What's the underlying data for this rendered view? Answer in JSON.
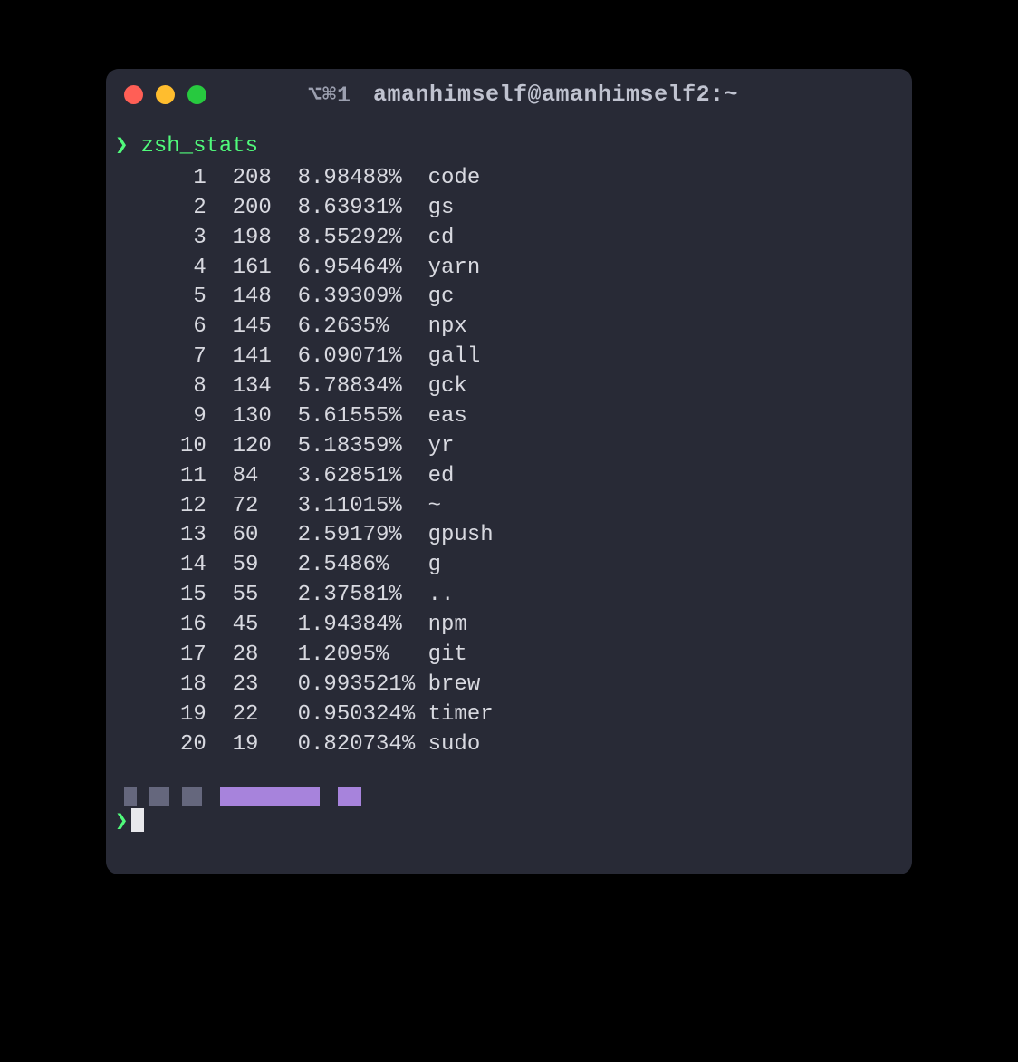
{
  "window": {
    "tab_indicator": "⌥⌘1",
    "title": "amanhimself@amanhimself2:~"
  },
  "prompt": {
    "arrow": "❯",
    "command": "zsh_stats"
  },
  "stats": [
    {
      "rank": "1",
      "count": "208",
      "percent": "8.98488%",
      "cmd": "code"
    },
    {
      "rank": "2",
      "count": "200",
      "percent": "8.63931%",
      "cmd": "gs"
    },
    {
      "rank": "3",
      "count": "198",
      "percent": "8.55292%",
      "cmd": "cd"
    },
    {
      "rank": "4",
      "count": "161",
      "percent": "6.95464%",
      "cmd": "yarn"
    },
    {
      "rank": "5",
      "count": "148",
      "percent": "6.39309%",
      "cmd": "gc"
    },
    {
      "rank": "6",
      "count": "145",
      "percent": "6.2635%",
      "cmd": "npx"
    },
    {
      "rank": "7",
      "count": "141",
      "percent": "6.09071%",
      "cmd": "gall"
    },
    {
      "rank": "8",
      "count": "134",
      "percent": "5.78834%",
      "cmd": "gck"
    },
    {
      "rank": "9",
      "count": "130",
      "percent": "5.61555%",
      "cmd": "eas"
    },
    {
      "rank": "10",
      "count": "120",
      "percent": "5.18359%",
      "cmd": "yr"
    },
    {
      "rank": "11",
      "count": "84",
      "percent": "3.62851%",
      "cmd": "ed"
    },
    {
      "rank": "12",
      "count": "72",
      "percent": "3.11015%",
      "cmd": "~"
    },
    {
      "rank": "13",
      "count": "60",
      "percent": "2.59179%",
      "cmd": "gpush"
    },
    {
      "rank": "14",
      "count": "59",
      "percent": "2.5486%",
      "cmd": "g"
    },
    {
      "rank": "15",
      "count": "55",
      "percent": "2.37581%",
      "cmd": ".."
    },
    {
      "rank": "16",
      "count": "45",
      "percent": "1.94384%",
      "cmd": "npm"
    },
    {
      "rank": "17",
      "count": "28",
      "percent": "1.2095%",
      "cmd": "git"
    },
    {
      "rank": "18",
      "count": "23",
      "percent": "0.993521%",
      "cmd": "brew"
    },
    {
      "rank": "19",
      "count": "22",
      "percent": "0.950324%",
      "cmd": "timer"
    },
    {
      "rank": "20",
      "count": "19",
      "percent": "0.820734%",
      "cmd": "sudo"
    }
  ]
}
